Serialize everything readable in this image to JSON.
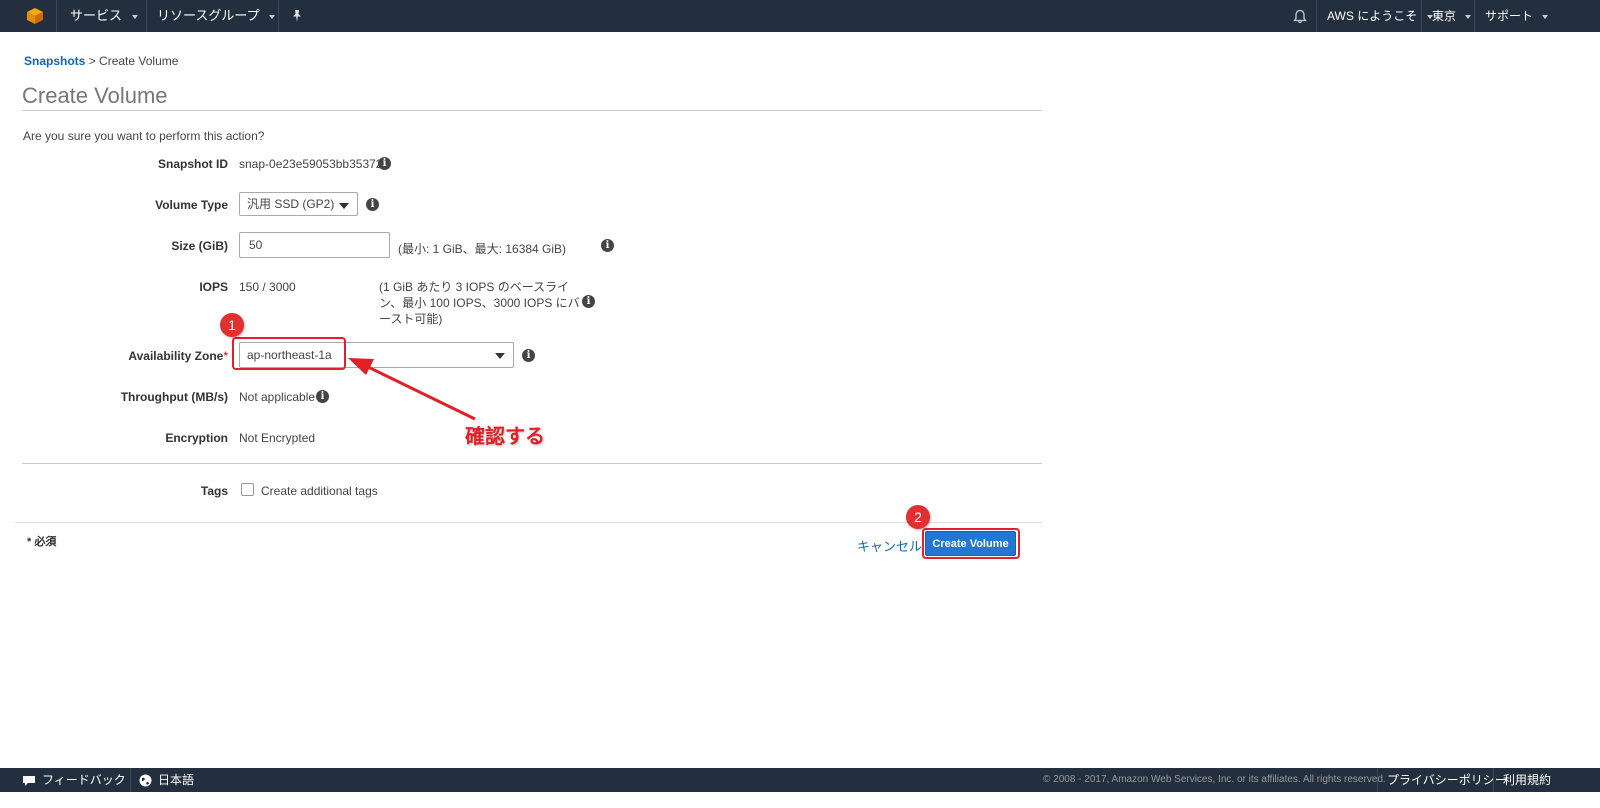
{
  "header": {
    "services": "サービス",
    "resource_groups": "リソースグループ",
    "welcome": "AWS にようこそ",
    "region": "東京",
    "support": "サポート"
  },
  "breadcrumb": {
    "link": "Snapshots",
    "separator": ">",
    "current": "Create Volume"
  },
  "title": "Create Volume",
  "question": "Are you sure you want to perform this action?",
  "form": {
    "snapshot_id_label": "Snapshot ID",
    "snapshot_id_value": "snap-0e23e59053bb35372",
    "volume_type_label": "Volume Type",
    "volume_type_value": "汎用 SSD (GP2)",
    "size_label": "Size (GiB)",
    "size_value": "50",
    "size_hint": "(最小: 1 GiB、最大: 16384 GiB)",
    "iops_label": "IOPS",
    "iops_value": "150 / 3000",
    "iops_hint_1": "(1 GiB あたり 3 IOPS のベースライ",
    "iops_hint_2": "ン、最小 100 IOPS、3000 IOPS にバ",
    "iops_hint_3": "ースト可能)",
    "az_label": "Availability Zone",
    "az_required_mark": "*",
    "az_value": "ap-northeast-1a",
    "throughput_label": "Throughput (MB/s)",
    "throughput_value": "Not applicable",
    "encryption_label": "Encryption",
    "encryption_value": "Not Encrypted",
    "tags_label": "Tags",
    "tags_checkbox_label": "Create additional tags"
  },
  "annotations": {
    "badge1": "1",
    "badge2": "2",
    "note": "確認する"
  },
  "footer_actions": {
    "required_note": "* 必須",
    "cancel": "キャンセル",
    "create": "Create Volume"
  },
  "footer": {
    "feedback": "フィードバック",
    "language": "日本語",
    "copyright": "© 2008 - 2017, Amazon Web Services, Inc. or its affiliates. All rights reserved.",
    "privacy": "プライバシーポリシー",
    "terms": "利用規約"
  },
  "colors": {
    "accent": "#2177d1",
    "annotation": "#e21f26",
    "topbar": "#232f3e"
  }
}
